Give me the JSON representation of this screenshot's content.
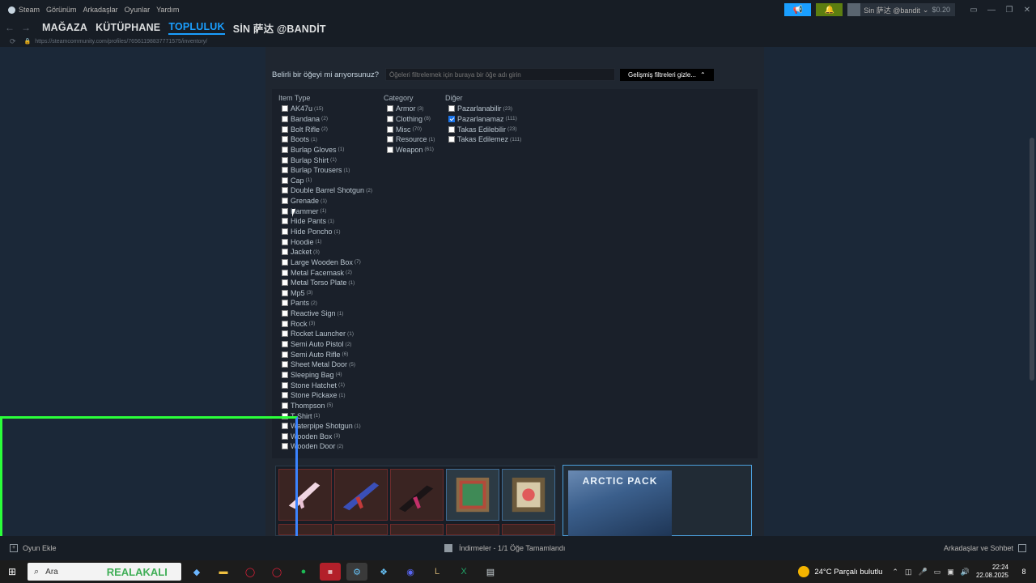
{
  "menubar": {
    "items": [
      "Steam",
      "Görünüm",
      "Arkadaşlar",
      "Oyunlar",
      "Yardım"
    ]
  },
  "account": {
    "name": "Sin 萨达 @bandit",
    "balance": "$0.20"
  },
  "nav": {
    "tabs": [
      "MAĞAZA",
      "KÜTÜPHANE",
      "TOPLULUK",
      "SİN 萨达 @BANDİT"
    ],
    "active": "TOPLULUK"
  },
  "url": "https://steamcommunity.com/profiles/76561198837771575/inventory/",
  "filter": {
    "label": "Belirli bir öğeyi mi arıyorsunuz?",
    "placeholder": "Öğeleri filtrelemek için buraya bir öğe adı girin",
    "advanced_button": "Gelişmiş filtreleri gizle..."
  },
  "item_type": {
    "heading": "Item Type",
    "items": [
      {
        "name": "AK47u",
        "count": "(15)"
      },
      {
        "name": "Bandana",
        "count": "(2)"
      },
      {
        "name": "Bolt Rifle",
        "count": "(2)"
      },
      {
        "name": "Boots",
        "count": "(1)"
      },
      {
        "name": "Burlap Gloves",
        "count": "(1)"
      },
      {
        "name": "Burlap Shirt",
        "count": "(1)"
      },
      {
        "name": "Burlap Trousers",
        "count": "(1)"
      },
      {
        "name": "Cap",
        "count": "(1)"
      },
      {
        "name": "Double Barrel Shotgun",
        "count": "(2)"
      },
      {
        "name": "Grenade",
        "count": "(1)"
      },
      {
        "name": "Hammer",
        "count": "(1)"
      },
      {
        "name": "Hide Pants",
        "count": "(1)"
      },
      {
        "name": "Hide Poncho",
        "count": "(1)"
      },
      {
        "name": "Hoodie",
        "count": "(1)"
      },
      {
        "name": "Jacket",
        "count": "(3)"
      },
      {
        "name": "Large Wooden Box",
        "count": "(7)"
      },
      {
        "name": "Metal Facemask",
        "count": "(2)"
      },
      {
        "name": "Metal Torso Plate",
        "count": "(1)"
      },
      {
        "name": "Mp5",
        "count": "(3)"
      },
      {
        "name": "Pants",
        "count": "(2)"
      },
      {
        "name": "Reactive Sign",
        "count": "(1)"
      },
      {
        "name": "Rock",
        "count": "(3)"
      },
      {
        "name": "Rocket Launcher",
        "count": "(1)"
      },
      {
        "name": "Semi Auto Pistol",
        "count": "(2)"
      },
      {
        "name": "Semi Auto Rifle",
        "count": "(6)"
      },
      {
        "name": "Sheet Metal Door",
        "count": "(5)"
      },
      {
        "name": "Sleeping Bag",
        "count": "(4)"
      },
      {
        "name": "Stone Hatchet",
        "count": "(1)"
      },
      {
        "name": "Stone Pickaxe",
        "count": "(1)"
      },
      {
        "name": "Thompson",
        "count": "(5)"
      },
      {
        "name": "T-Shirt",
        "count": "(1)"
      },
      {
        "name": "Waterpipe Shotgun",
        "count": "(1)"
      },
      {
        "name": "Wooden Box",
        "count": "(3)"
      },
      {
        "name": "Wooden Door",
        "count": "(2)"
      }
    ]
  },
  "category": {
    "heading": "Category",
    "items": [
      {
        "name": "Armor",
        "count": "(3)"
      },
      {
        "name": "Clothing",
        "count": "(8)"
      },
      {
        "name": "Misc",
        "count": "(70)"
      },
      {
        "name": "Resource",
        "count": "(1)"
      },
      {
        "name": "Weapon",
        "count": "(61)"
      }
    ]
  },
  "other": {
    "heading": "Diğer",
    "items": [
      {
        "name": "Pazarlanabilir",
        "count": "(23)",
        "checked": false
      },
      {
        "name": "Pazarlanamaz",
        "count": "(111)",
        "checked": true
      },
      {
        "name": "Takas Edilebilir",
        "count": "(23)",
        "checked": false
      },
      {
        "name": "Takas Edilemez",
        "count": "(111)",
        "checked": false
      }
    ]
  },
  "featured": {
    "title": "ARCTIC PACK"
  },
  "steam_bottom": {
    "add_game": "Oyun Ekle",
    "downloads": "İndirmeler - 1/1 Öğe Tamamlandı",
    "friends": "Arkadaşlar ve Sohbet"
  },
  "taskbar": {
    "search_placeholder": "Ara",
    "weather": "24°C  Parçalı bulutlu",
    "time": "22:24",
    "date": "22.08.2025",
    "notifications": "8",
    "overlay_text": "REALAKALI"
  }
}
